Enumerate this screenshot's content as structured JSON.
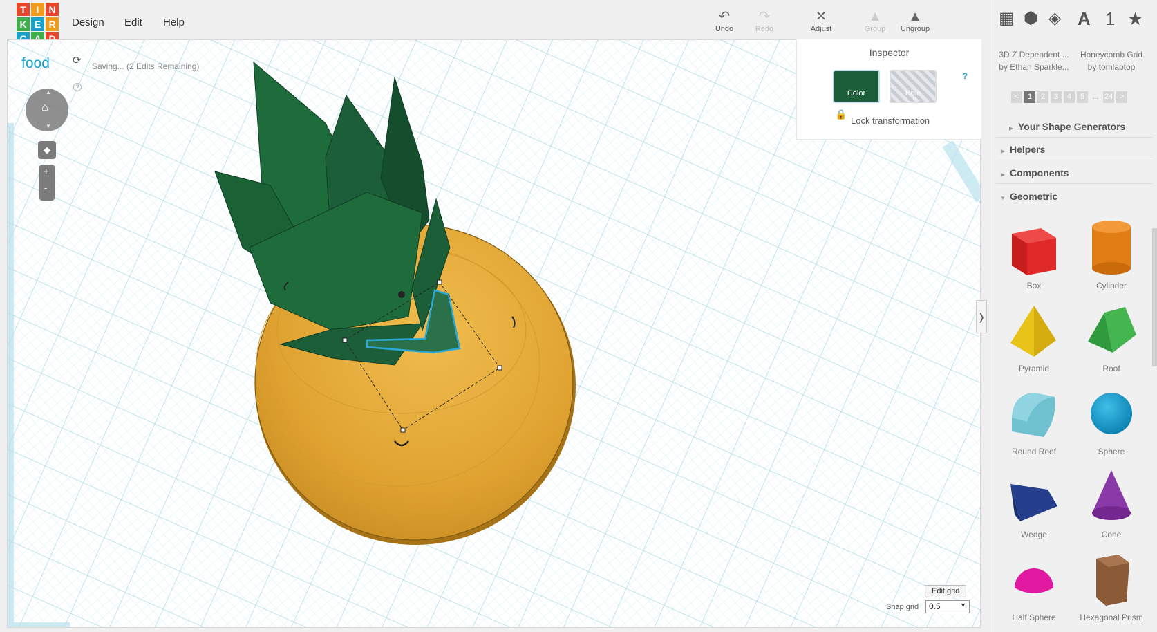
{
  "logo": [
    "T",
    "I",
    "N",
    "K",
    "E",
    "R",
    "C",
    "A",
    "D"
  ],
  "menu": {
    "design": "Design",
    "edit": "Edit",
    "help": "Help"
  },
  "toolbar": {
    "undo": "Undo",
    "redo": "Redo",
    "adjust": "Adjust",
    "group": "Group",
    "ungroup": "Ungroup"
  },
  "project": {
    "name": "food",
    "status": "Saving... (2 Edits Remaining)"
  },
  "inspector": {
    "title": "Inspector",
    "color_label": "Color",
    "hole_label": "Hole",
    "help": "?",
    "lock_label": "Lock transformation",
    "color_value": "#1b5e38"
  },
  "sidebar": {
    "icon_glyphs": [
      "A",
      "1",
      "★"
    ],
    "generators": [
      {
        "name": "3D Z Dependent ...",
        "author": "by Ethan Sparkle..."
      },
      {
        "name": "Honeycomb Grid",
        "author": "by tomlaptop"
      }
    ],
    "pager": [
      "<",
      "1",
      "2",
      "3",
      "4",
      "5",
      "...",
      "24",
      ">"
    ],
    "sections": [
      "Your Shape Generators",
      "Helpers",
      "Components",
      "Geometric"
    ],
    "shapes": [
      "Box",
      "Cylinder",
      "Pyramid",
      "Roof",
      "Round Roof",
      "Sphere",
      "Wedge",
      "Cone",
      "Half Sphere",
      "Hexagonal Prism"
    ]
  },
  "grid": {
    "edit_label": "Edit grid",
    "snap_label": "Snap grid",
    "snap_value": "0.5"
  },
  "colors": {
    "grid_line": "#bfe3ee",
    "sphere": "#e3a83a",
    "leaf": "#1b5e38",
    "accent": "#1aa0c8"
  }
}
